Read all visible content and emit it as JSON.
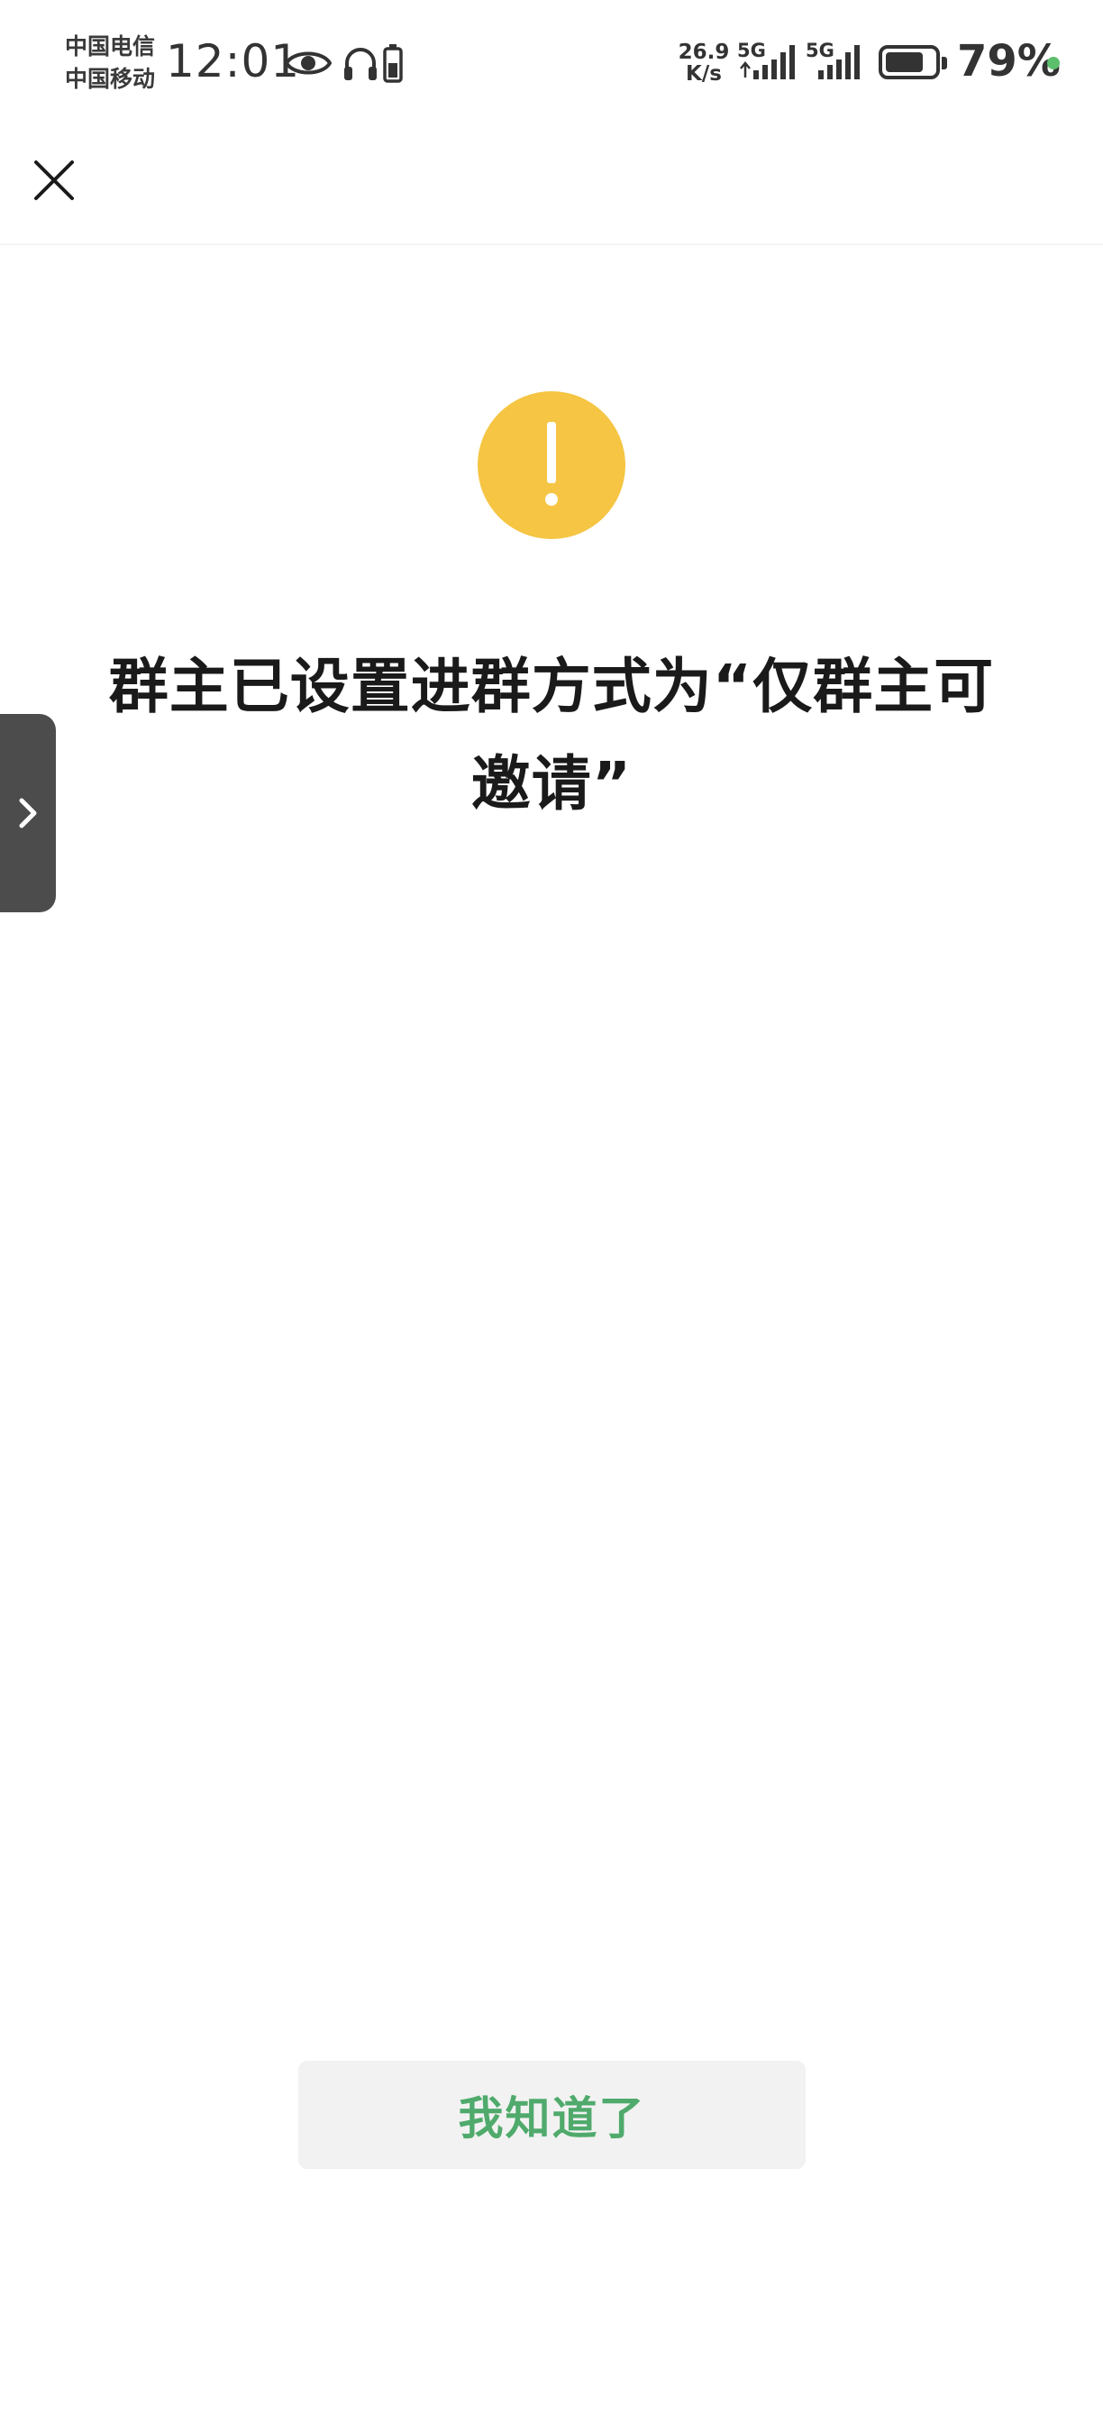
{
  "status_bar": {
    "carrier_1": "中国电信",
    "carrier_2": "中国移动",
    "time": "12:01",
    "net_speed_value": "26.9",
    "net_speed_unit": "K/s",
    "signal_1_label": "5G",
    "signal_2_label": "5G",
    "battery_percent": "79%",
    "battery_level": 0.79,
    "icons": [
      "eye-icon",
      "headphones-icon",
      "headphone-battery-icon",
      "signal-bars-icon",
      "battery-icon"
    ],
    "indicator_color": "#5cbf6c"
  },
  "header": {
    "close_icon": "close-icon"
  },
  "side_tab": {
    "icon": "chevron-right-icon"
  },
  "main": {
    "icon": "exclamation-icon",
    "icon_color": "#f5c543",
    "message": "群主已设置进群方式为“仅群主可邀请”"
  },
  "footer": {
    "button_label": "我知道了",
    "button_text_color": "#4faa6c"
  }
}
